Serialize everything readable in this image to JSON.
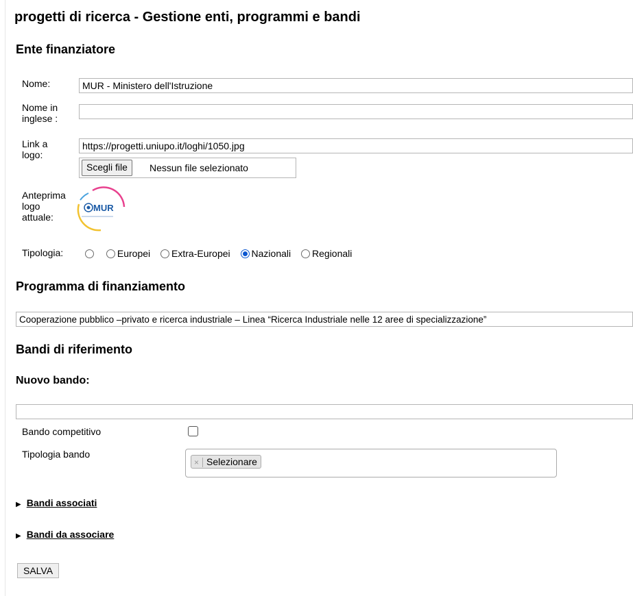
{
  "page": {
    "title": "progetti di ricerca - Gestione enti, programmi e bandi"
  },
  "ente": {
    "heading": "Ente finanziatore",
    "nome_label": "Nome:",
    "nome_value": "MUR - Ministero dell'Istruzione",
    "nome_inglese_label_1": "Nome in",
    "nome_inglese_label_2": "inglese :",
    "nome_inglese_value": "",
    "link_logo_label_1": "Link a",
    "link_logo_label_2": "logo:",
    "link_logo_value": "https://progetti.uniupo.it/loghi/1050.jpg",
    "file_button_label": "Scegli file",
    "file_status": "Nessun file selezionato",
    "anteprima_label_1": "Anteprima",
    "anteprima_label_2": "logo",
    "anteprima_label_3": "attuale:",
    "logo_text": "MUR",
    "tipologia_label": "Tipologia:",
    "tipologia_options": [
      "",
      "Europei",
      "Extra-Europei",
      "Nazionali",
      "Regionali"
    ],
    "tipologia_selected": "Nazionali"
  },
  "programma": {
    "heading": "Programma di finanziamento",
    "value": "Cooperazione pubblico –privato e ricerca industriale – Linea “Ricerca Industriale nelle 12 aree di specializzazione”"
  },
  "bandi": {
    "heading": "Bandi di riferimento",
    "nuovo_heading": "Nuovo bando:",
    "nuovo_value": "",
    "competitivo_label": "Bando competitivo",
    "competitivo_checked": false,
    "tipologia_label": "Tipologia bando",
    "tipologia_tag_remove": "×",
    "tipologia_tag": "Selezionare",
    "associati_label": "Bandi associati",
    "da_associare_label": "Bandi da associare"
  },
  "actions": {
    "save_label": "SALVA"
  },
  "colors": {
    "radio_accent": "#0b57d0",
    "logo_arc_pink": "#e8418e",
    "logo_arc_yellow": "#f2c230",
    "logo_arc_blue": "#4aa3df",
    "logo_text": "#1a5aa6"
  }
}
